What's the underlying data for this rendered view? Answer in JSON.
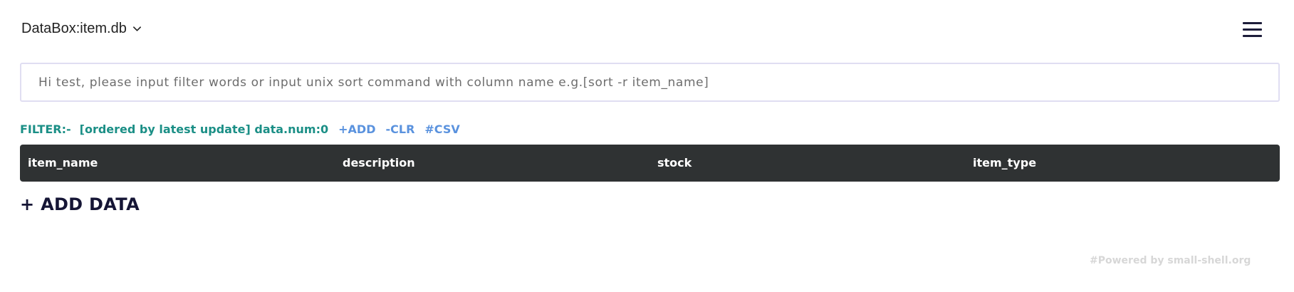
{
  "header": {
    "db_label": "DataBox:item.db",
    "db_chevron_icon": "chevron-down-icon",
    "menu_icon": "hamburger-menu-icon"
  },
  "filter": {
    "placeholder": "Hi test, please input filter words or input unix sort command with column name e.g.[sort -r item_name]"
  },
  "status": {
    "filter_label": "FILTER:-",
    "order_info": "[ordered by latest update] data.num:0",
    "add_link": "+ADD",
    "clear_link": "-CLR",
    "csv_link": "#CSV"
  },
  "table": {
    "columns": [
      "item_name",
      "description",
      "stock",
      "item_type"
    ]
  },
  "actions": {
    "add_data": "+ ADD DATA"
  },
  "footer": {
    "powered_by": "#Powered by small-shell.org"
  },
  "colors": {
    "teal": "#1b8f86",
    "link_blue": "#5a92de",
    "header_dark": "#2f3233",
    "add_data_navy": "#151535",
    "footer_gray": "#d7d7d7"
  }
}
